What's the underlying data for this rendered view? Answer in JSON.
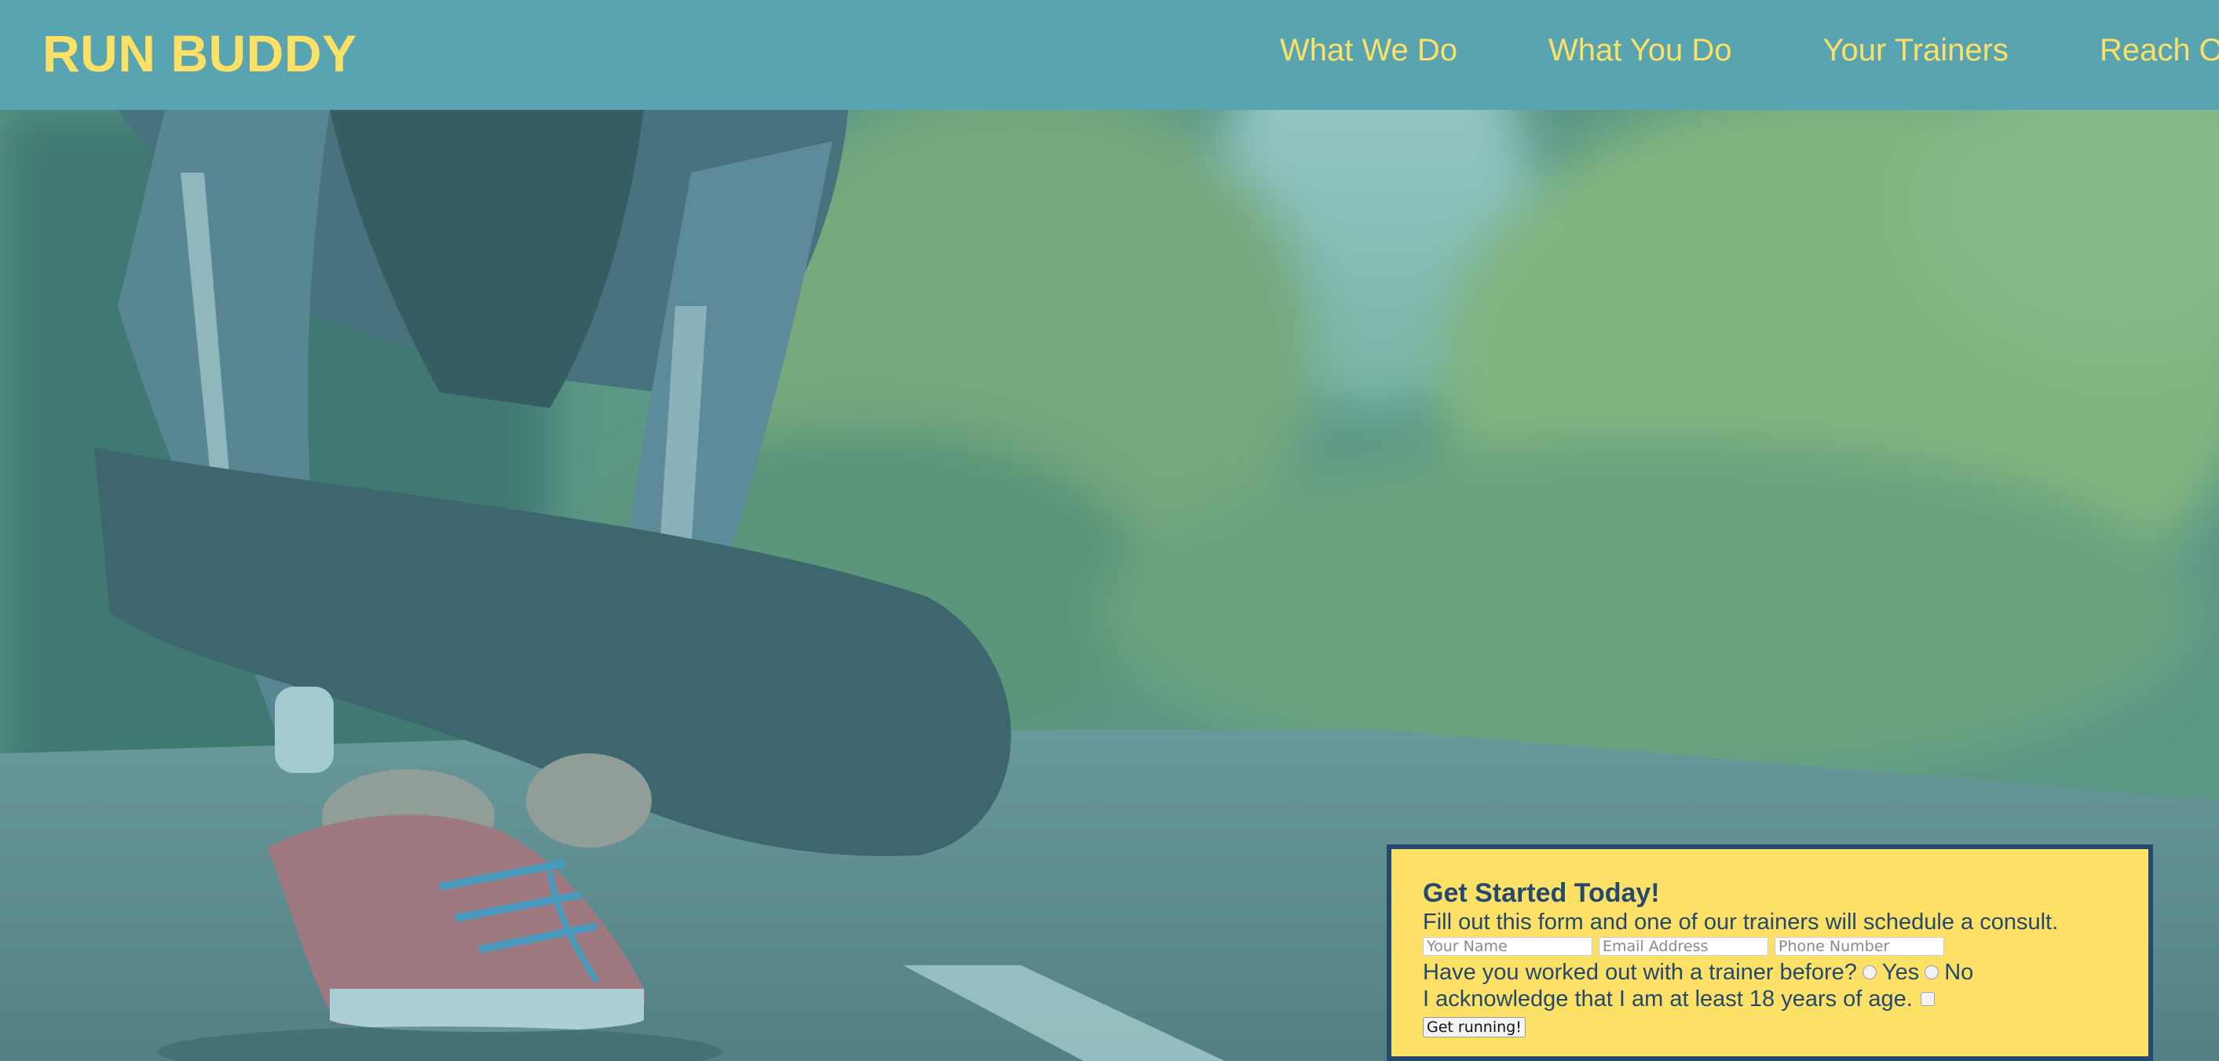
{
  "header": {
    "logo": "RUN BUDDY",
    "nav": [
      "What We Do",
      "What You Do",
      "Your Trainers",
      "Reach Out"
    ]
  },
  "form": {
    "title": "Get Started Today!",
    "description": "Fill out this form and one of our trainers will schedule a consult.",
    "name_placeholder": "Your Name",
    "email_placeholder": "Email Address",
    "phone_placeholder": "Phone Number",
    "trainer_question": "Have you worked out with a trainer before?",
    "yes_label": "Yes",
    "no_label": "No",
    "age_ack": "I acknowledge that I am at least 18 years of age.",
    "submit_label": "Get running!"
  },
  "colors": {
    "header_bg": "#58a4b1",
    "accent_yellow": "#fce166",
    "navy": "#24486e"
  }
}
